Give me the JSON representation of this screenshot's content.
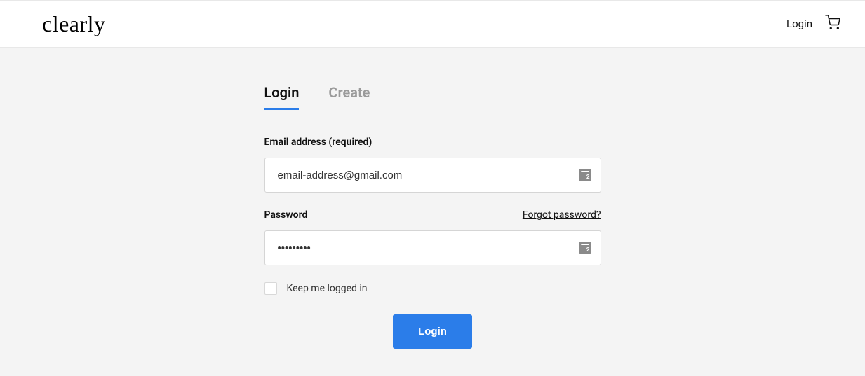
{
  "header": {
    "brand": "clearly",
    "login_link": "Login"
  },
  "tabs": {
    "login": "Login",
    "create": "Create"
  },
  "form": {
    "email_label": "Email address (required)",
    "email_value": "email-address@gmail.com",
    "password_label": "Password",
    "password_value": "•••••••••",
    "forgot_link": "Forgot password?",
    "keep_logged_label": "Keep me logged in",
    "submit_label": "Login"
  }
}
